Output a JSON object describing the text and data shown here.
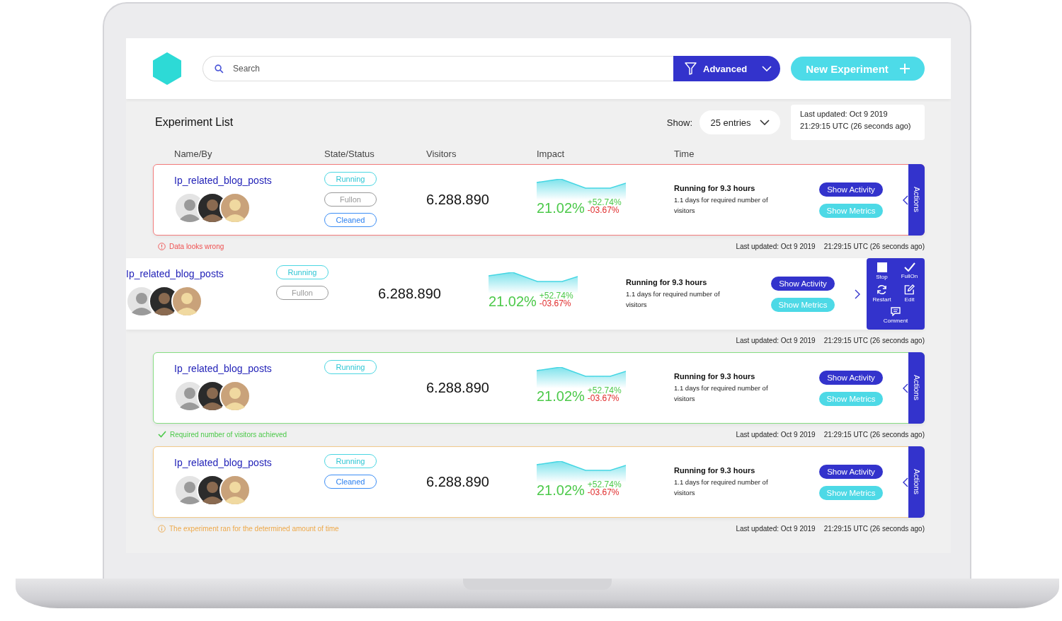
{
  "header": {
    "search": {
      "placeholder": "Search"
    },
    "filter_button": "Advanced",
    "new_button": "New Experiment"
  },
  "list": {
    "title": "Experiment List",
    "show_label": "Show:",
    "entries": "25 entries",
    "last_updated": [
      "Last updated: Oct 9 2019",
      "21:29:15 UTC (26 seconds ago)"
    ]
  },
  "columns": [
    "Name/By",
    "State/Status",
    "Visitors",
    "Impact",
    "Time"
  ],
  "experiments": [
    {
      "name": "Ip_related_blog_posts",
      "statuses": [
        {
          "kind": "running",
          "label": "Running"
        },
        {
          "kind": "fullon",
          "label": "Fullon"
        },
        {
          "kind": "cleaned",
          "label": "Cleaned"
        }
      ],
      "visitors": "6.288.890",
      "impact": {
        "value": "21.02%",
        "up": "+52.74%",
        "down": "-03.67%"
      },
      "time_title": "Running for 9.3 hours",
      "time_detail": "1.1 days for required number of visitors",
      "buttons": [
        {
          "kind": "primary",
          "label": "Show Activity"
        },
        {
          "kind": "secondary",
          "label": "Show Metrics"
        }
      ],
      "expanded": false,
      "actions_label": "Actions",
      "alert": {
        "kind": "error",
        "text": "Data looks wrong"
      },
      "updated": [
        "Last updated: Oct 9 2019",
        "21:29:15 UTC (26 seconds ago)"
      ]
    },
    {
      "name": "Ip_related_blog_posts",
      "statuses": [
        {
          "kind": "running",
          "label": "Running"
        },
        {
          "kind": "fullon",
          "label": "Fullon"
        }
      ],
      "visitors": "6.288.890",
      "impact": {
        "value": "21.02%",
        "up": "+52.74%",
        "down": "-03.67%"
      },
      "time_title": "Running for 9.3 hours",
      "time_detail": "1.1 days for required number of visitors",
      "buttons": [
        {
          "kind": "primary",
          "label": "Show Activity"
        },
        {
          "kind": "secondary",
          "label": "Show Metrics"
        }
      ],
      "expanded": true,
      "actions": [
        {
          "kind": "stop",
          "label": "Stop"
        },
        {
          "kind": "fullon",
          "label": "FullOn"
        },
        {
          "kind": "restart",
          "label": "Restart"
        },
        {
          "kind": "edit",
          "label": "Edit"
        },
        {
          "kind": "comment",
          "label": "Comment"
        }
      ],
      "updated": [
        "Last updated: Oct 9 2019",
        "21:29:15 UTC (26 seconds ago)"
      ]
    },
    {
      "name": "Ip_related_blog_posts",
      "statuses": [
        {
          "kind": "running",
          "label": "Running"
        }
      ],
      "visitors": "6.288.890",
      "impact": {
        "value": "21.02%",
        "up": "+52.74%",
        "down": "-03.67%"
      },
      "time_title": "Running for 9.3 hours",
      "time_detail": "1.1 days for required number of visitors",
      "buttons": [
        {
          "kind": "primary",
          "label": "Show Activity"
        },
        {
          "kind": "secondary",
          "label": "Show Metrics"
        }
      ],
      "expanded": false,
      "actions_label": "Actions",
      "alert": {
        "kind": "success",
        "text": "Required number of visitors achieved"
      },
      "updated": [
        "Last updated: Oct 9 2019",
        "21:29:15 UTC (26 seconds ago)"
      ]
    },
    {
      "name": "Ip_related_blog_posts",
      "statuses": [
        {
          "kind": "running",
          "label": "Running"
        },
        {
          "kind": "cleaned",
          "label": "Cleaned"
        }
      ],
      "visitors": "6.288.890",
      "impact": {
        "value": "21.02%",
        "up": "+52.74%",
        "down": "-03.67%"
      },
      "time_title": "Running for 9.3 hours",
      "time_detail": "1.1 days for required number of visitors",
      "buttons": [
        {
          "kind": "primary",
          "label": "Show Activity"
        },
        {
          "kind": "secondary",
          "label": "Show Metrics"
        }
      ],
      "expanded": false,
      "actions_label": "Actions",
      "alert": {
        "kind": "info",
        "text": "The experiment ran for the determined amount of time"
      },
      "updated": [
        "Last updated: Oct 9 2019",
        "21:29:15 UTC (26 seconds ago)"
      ]
    }
  ]
}
